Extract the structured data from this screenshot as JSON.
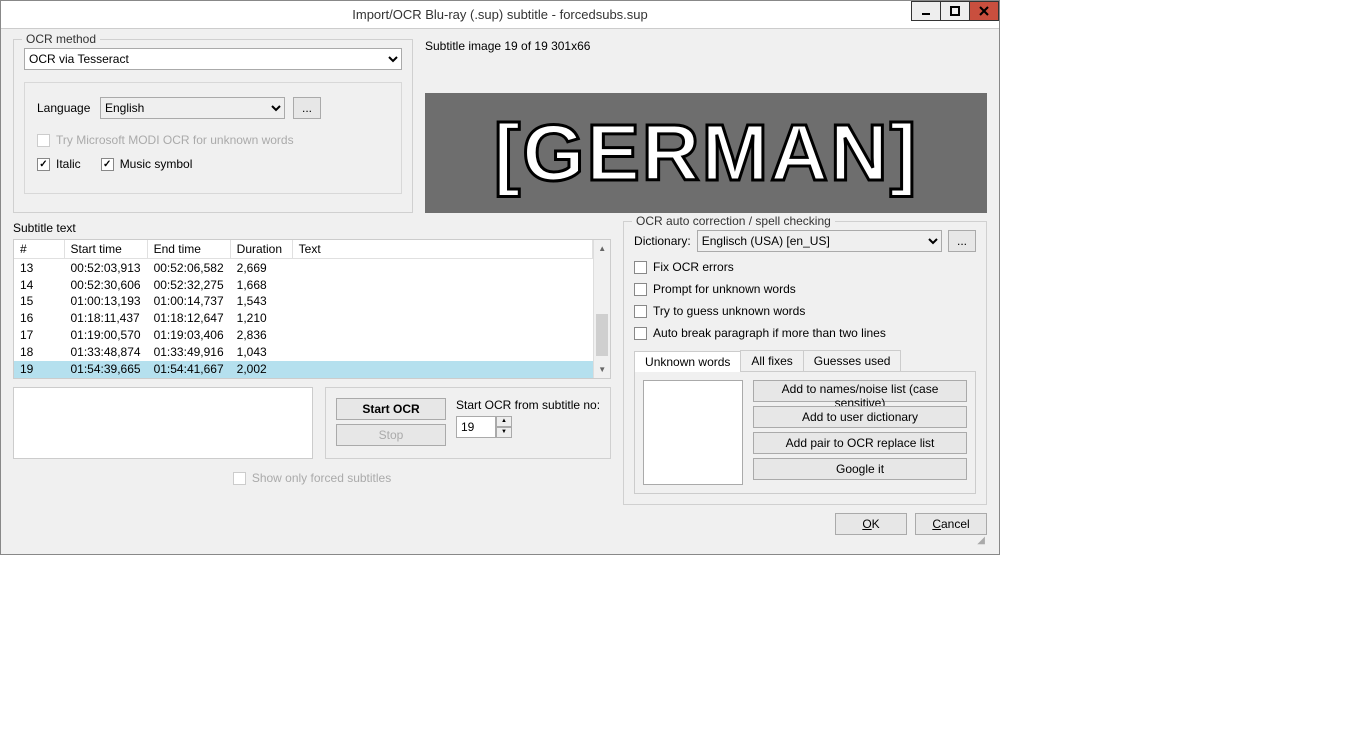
{
  "window": {
    "title": "Import/OCR Blu-ray (.sup) subtitle - forcedsubs.sup"
  },
  "ocr_method": {
    "legend": "OCR method",
    "selected": "OCR via Tesseract",
    "language_label": "Language",
    "language_value": "English",
    "try_modi": "Try Microsoft MODI OCR for unknown words",
    "italic": "Italic",
    "music": "Music symbol"
  },
  "preview": {
    "label": "Subtitle image 19 of 19   301x66",
    "text": "[GERMAN]"
  },
  "subtitle_text": {
    "legend": "Subtitle text",
    "headers": {
      "num": "#",
      "start": "Start time",
      "end": "End time",
      "duration": "Duration",
      "text": "Text"
    },
    "rows": [
      {
        "n": "13",
        "start": "00:52:03,913",
        "end": "00:52:06,582",
        "dur": "2,669",
        "text": ""
      },
      {
        "n": "14",
        "start": "00:52:30,606",
        "end": "00:52:32,275",
        "dur": "1,668",
        "text": ""
      },
      {
        "n": "15",
        "start": "01:00:13,193",
        "end": "01:00:14,737",
        "dur": "1,543",
        "text": ""
      },
      {
        "n": "16",
        "start": "01:18:11,437",
        "end": "01:18:12,647",
        "dur": "1,210",
        "text": ""
      },
      {
        "n": "17",
        "start": "01:19:00,570",
        "end": "01:19:03,406",
        "dur": "2,836",
        "text": ""
      },
      {
        "n": "18",
        "start": "01:33:48,874",
        "end": "01:33:49,916",
        "dur": "1,043",
        "text": ""
      },
      {
        "n": "19",
        "start": "01:54:39,665",
        "end": "01:54:41,667",
        "dur": "2,002",
        "text": ""
      }
    ],
    "selected_index": 6
  },
  "ocr_auto": {
    "legend": "OCR auto correction / spell checking",
    "dictionary_label": "Dictionary:",
    "dictionary_value": "Englisch (USA) [en_US]",
    "fix_errors": "Fix OCR errors",
    "prompt_unknown": "Prompt for unknown words",
    "try_guess": "Try to guess unknown words",
    "auto_break": "Auto break paragraph if more than two lines",
    "tabs": {
      "unknown": "Unknown words",
      "allfixes": "All fixes",
      "guesses": "Guesses used"
    },
    "buttons": {
      "add_names": "Add to names/noise list (case sensitive)",
      "add_dict": "Add to user dictionary",
      "add_pair": "Add pair to OCR replace list",
      "google": "Google it"
    }
  },
  "start_ocr": {
    "start": "Start OCR",
    "stop": "Stop",
    "from_label": "Start OCR from subtitle no:",
    "from_value": "19"
  },
  "show_only": "Show only forced subtitles",
  "dialog": {
    "ok": "OK",
    "cancel": "Cancel"
  }
}
